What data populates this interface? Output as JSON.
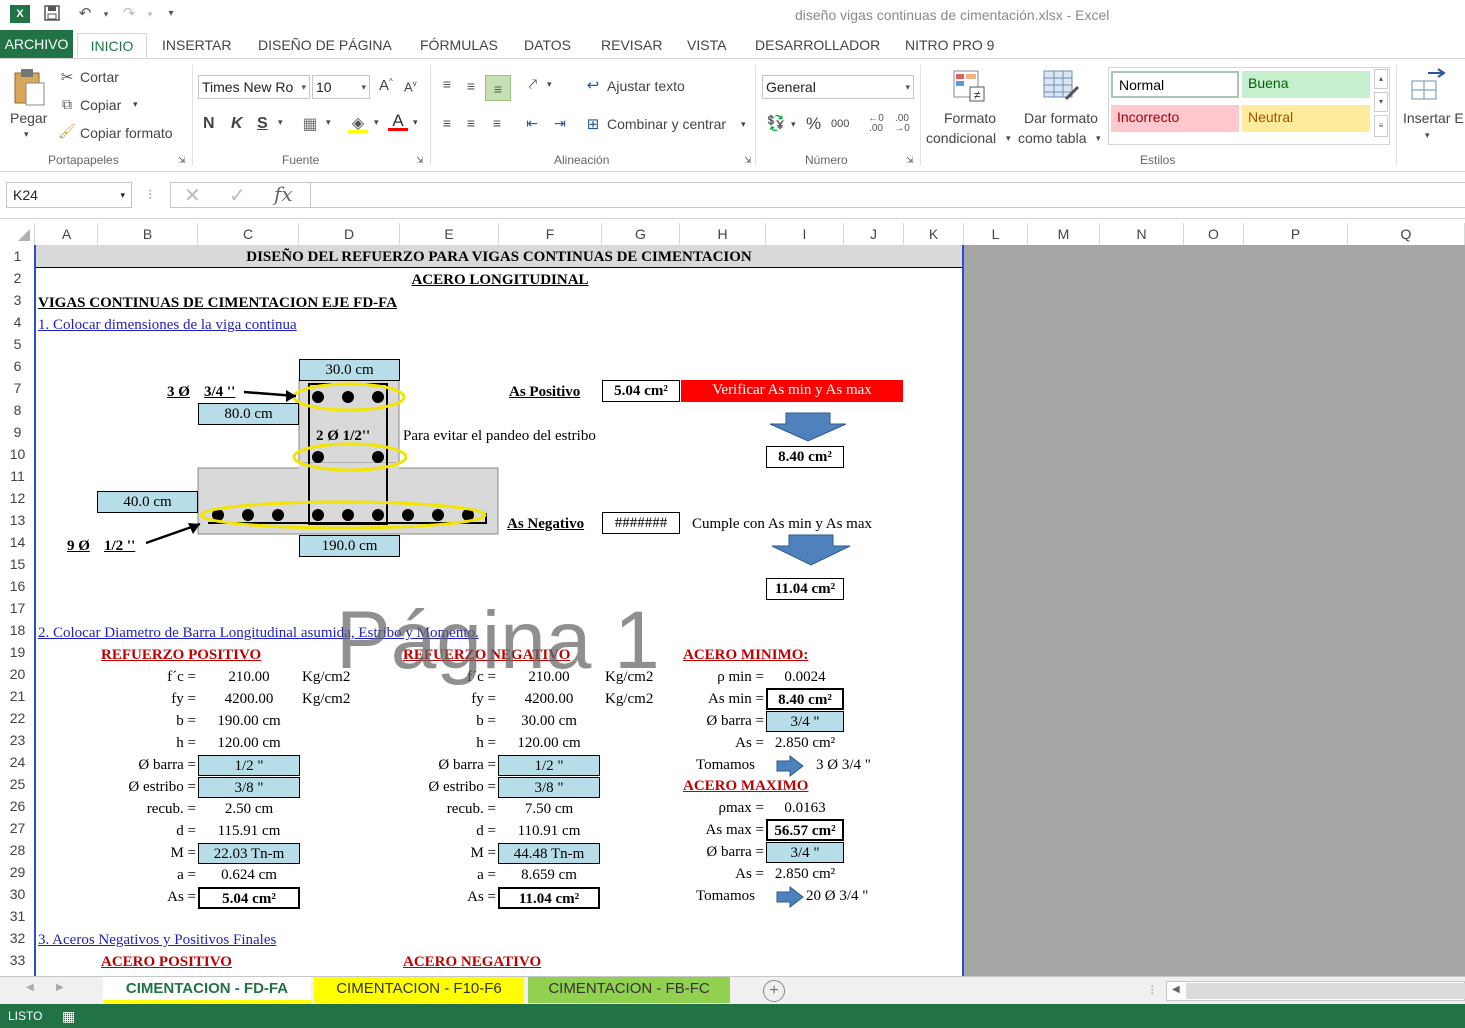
{
  "window": {
    "title": "diseño vigas continuas de cimentación.xlsx - Excel"
  },
  "tabs": [
    {
      "label": "ARCHIVO"
    },
    {
      "label": "INICIO"
    },
    {
      "label": "INSERTAR"
    },
    {
      "label": "DISEÑO DE PÁGINA"
    },
    {
      "label": "FÓRMULAS"
    },
    {
      "label": "DATOS"
    },
    {
      "label": "REVISAR"
    },
    {
      "label": "VISTA"
    },
    {
      "label": "DESARROLLADOR"
    },
    {
      "label": "NITRO PRO 9"
    }
  ],
  "ribbon": {
    "clipboard": {
      "paste": "Pegar",
      "cut": "Cortar",
      "copy": "Copiar",
      "format_painter": "Copiar formato",
      "label": "Portapapeles"
    },
    "font": {
      "name": "Times New Ro",
      "size": "10",
      "label": "Fuente",
      "bold": "N",
      "italic": "K",
      "underline": "S"
    },
    "alignment": {
      "wrap": "Ajustar texto",
      "merge": "Combinar y centrar",
      "label": "Alineación"
    },
    "number": {
      "format": "General",
      "percent": "%",
      "thousands": "000",
      "label": "Número"
    },
    "styles": {
      "cond_format_1": "Formato",
      "cond_format_2": "condicional",
      "table_format_1": "Dar formato",
      "table_format_2": "como tabla",
      "normal": "Normal",
      "good": "Buena",
      "bad": "Incorrecto",
      "neutral": "Neutral",
      "label": "Estilos"
    },
    "cells": {
      "insert": "Insertar E"
    }
  },
  "formula_bar": {
    "name_box": "K24",
    "fx": "fx",
    "value": ""
  },
  "columns": [
    "A",
    "B",
    "C",
    "D",
    "E",
    "F",
    "G",
    "H",
    "I",
    "J",
    "K",
    "L",
    "M",
    "N",
    "O",
    "P",
    "Q"
  ],
  "rows": [
    "1",
    "2",
    "3",
    "4",
    "5",
    "6",
    "7",
    "8",
    "9",
    "10",
    "11",
    "12",
    "13",
    "14",
    "15",
    "16",
    "17",
    "18",
    "19",
    "20",
    "21",
    "22",
    "23",
    "24",
    "25",
    "26",
    "27",
    "28",
    "29",
    "30",
    "31",
    "32",
    "33"
  ],
  "sheet": {
    "title": "DISEÑO DEL REFUERZO PARA VIGAS CONTINUAS DE CIMENTACION",
    "subtitle": "ACERO LONGITUDINAL",
    "axis": "VIGAS CONTINUAS DE CIMENTACION EJE FD-FA",
    "step1": "1. Colocar dimensiones de la viga continua",
    "dim_top": "30.0 cm",
    "dim_mid": "80.0 cm",
    "dim_left": "40.0 cm",
    "dim_bottom": "190.0 cm",
    "bars_top_n": "3 Ø",
    "bars_top_d": "3/4 ''",
    "bars_mid": "2  Ø  1/2''",
    "bars_mid_note": "Para evitar el pandeo del estribo",
    "bars_bot_n": "9 Ø",
    "bars_bot_d": "1/2 ''",
    "as_pos_label": "As Positivo",
    "as_pos_value": "5.04 cm²",
    "as_pos_warning": "Verificar As min y As max",
    "as_pos_result": "8.40 cm²",
    "as_neg_label": "As Negativo",
    "as_neg_value": "#######",
    "as_neg_note": "Cumple con As min y As max",
    "as_neg_result": "11.04 cm²",
    "step2": "2. Colocar Diametro de Barra Longitudinal asumida, Estribo y Momento.",
    "pos": {
      "header": "REFUERZO POSITIVO",
      "fc_l": "f´c =",
      "fc": "210.00",
      "fc_u": "Kg/cm2",
      "fy_l": "fy =",
      "fy": "4200.00",
      "fy_u": "Kg/cm2",
      "b_l": "b =",
      "b": "190.00 cm",
      "h_l": "h =",
      "h": "120.00 cm",
      "bar_l": "Ø barra =",
      "bar": "1/2 \"",
      "est_l": "Ø estribo =",
      "est": "3/8 \"",
      "rec_l": "recub. =",
      "rec": "2.50 cm",
      "d_l": "d =",
      "d": "115.91 cm",
      "m_l": "M =",
      "m": "22.03 Tn-m",
      "a_l": "a =",
      "a": "0.624 cm",
      "as_l": "As =",
      "as": "5.04 cm²"
    },
    "neg": {
      "header": "REFUERZO NEGATIVO",
      "fc_l": "f´c =",
      "fc": "210.00",
      "fc_u": "Kg/cm2",
      "fy_l": "fy =",
      "fy": "4200.00",
      "fy_u": "Kg/cm2",
      "b_l": "b =",
      "b": "30.00 cm",
      "h_l": "h =",
      "h": "120.00 cm",
      "bar_l": "Ø barra =",
      "bar": "1/2 \"",
      "est_l": "Ø estribo =",
      "est": "3/8 \"",
      "rec_l": "recub. =",
      "rec": "7.50 cm",
      "d_l": "d =",
      "d": "110.91 cm",
      "m_l": "M =",
      "m": "44.48 Tn-m",
      "a_l": "a =",
      "a": "8.659 cm",
      "as_l": "As =",
      "as": "11.04 cm²"
    },
    "min": {
      "header": "ACERO MINIMO:",
      "rho_l": "ρ min =",
      "rho": "0.0024",
      "asmin_l": "As min =",
      "asmin": "8.40 cm²",
      "bar_l": "Ø barra =",
      "bar": "3/4 \"",
      "as_l": "As =",
      "as": "2.850 cm²",
      "take_l": "Tomamos",
      "take": "3 Ø   3/4 \""
    },
    "max": {
      "header": "ACERO MAXIMO",
      "rho_l": "ρmax =",
      "rho": "0.0163",
      "asmax_l": "As max =",
      "asmax": "56.57 cm²",
      "bar_l": "Ø barra =",
      "bar": "3/4 \"",
      "as_l": "As =",
      "as": "2.850 cm²",
      "take_l": "Tomamos",
      "take": "20 Ø   3/4 \""
    },
    "step3": "3. Aceros Negativos y Positivos Finales",
    "final_pos": "ACERO POSITIVO",
    "final_neg": "ACERO NEGATIVO",
    "watermark": "Página 1"
  },
  "sheet_tabs": [
    {
      "label": "CIMENTACION - FD-FA",
      "color": "#ffff00"
    },
    {
      "label": "CIMENTACION - F10-F6",
      "color": "#ffff00"
    },
    {
      "label": "CIMENTACION - FB-FC",
      "color": "#92d050"
    }
  ],
  "status": {
    "text": "LISTO"
  },
  "colors": {
    "excel_green": "#217346",
    "cell_blue": "#b7dde8",
    "warning_red": "#ff0000",
    "arrow_blue": "#4f81bd"
  }
}
